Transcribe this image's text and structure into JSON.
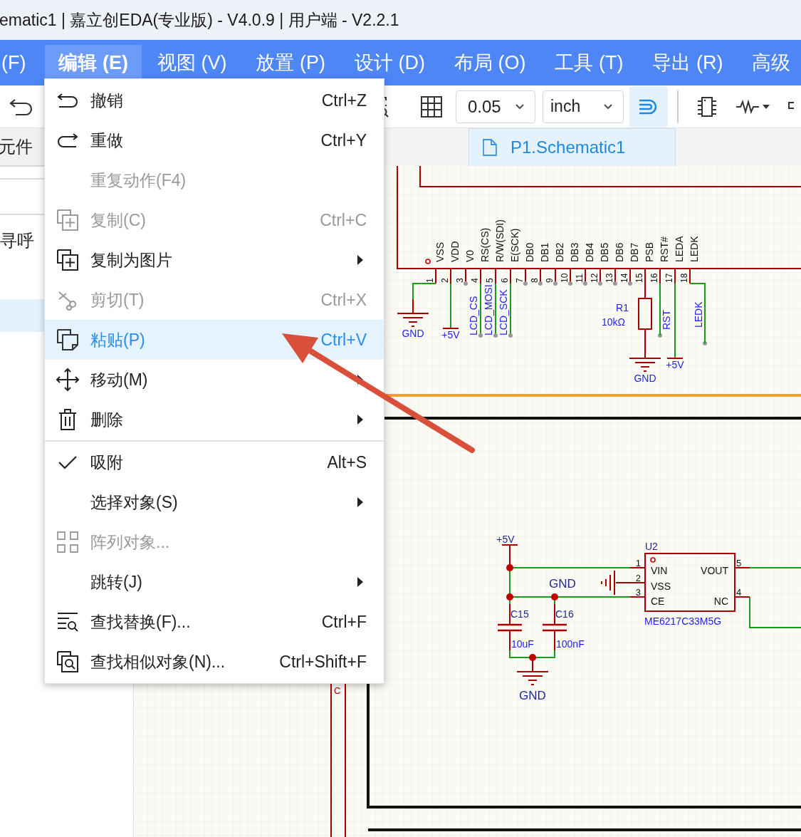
{
  "window": {
    "title": "ematic1 | 嘉立创EDA(专业版) - V4.0.9 | 用户端 - V2.2.1"
  },
  "menubar": [
    {
      "label": "(F)",
      "selected": false
    },
    {
      "label": "编辑 (E)",
      "selected": true
    },
    {
      "label": "视图 (V)",
      "selected": false
    },
    {
      "label": "放置 (P)",
      "selected": false
    },
    {
      "label": "设计 (D)",
      "selected": false
    },
    {
      "label": "布局 (O)",
      "selected": false
    },
    {
      "label": "工具 (T)",
      "selected": false
    },
    {
      "label": "导出 (R)",
      "selected": false
    },
    {
      "label": "高级",
      "selected": false
    }
  ],
  "toolbar": {
    "grid_size": "0.05",
    "unit": "inch",
    "snap_on": true
  },
  "left_panel": {
    "header": "元件",
    "item": "寻呼"
  },
  "tabs": [
    {
      "label": "P1.Schematic1",
      "selected": true
    }
  ],
  "edit_menu": [
    {
      "kind": "item",
      "label": "撤销",
      "shortcut": "Ctrl+Z",
      "disabled": false,
      "selected": false,
      "checked": false,
      "submenu": false
    },
    {
      "kind": "item",
      "label": "重做",
      "shortcut": "Ctrl+Y",
      "disabled": false,
      "selected": false,
      "checked": false,
      "submenu": false
    },
    {
      "kind": "item",
      "label": "重复动作(F4)",
      "disabled": true,
      "selected": false,
      "checked": false,
      "submenu": false
    },
    {
      "kind": "item",
      "label": "复制(C)",
      "shortcut": "Ctrl+C",
      "disabled": true,
      "selected": false,
      "checked": false,
      "submenu": false
    },
    {
      "kind": "item",
      "label": "复制为图片",
      "disabled": false,
      "selected": false,
      "checked": false,
      "submenu": true
    },
    {
      "kind": "item",
      "label": "剪切(T)",
      "shortcut": "Ctrl+X",
      "disabled": true,
      "selected": false,
      "checked": false,
      "submenu": false
    },
    {
      "kind": "item",
      "label": "粘贴(P)",
      "shortcut": "Ctrl+V",
      "disabled": false,
      "selected": true,
      "checked": false,
      "submenu": false
    },
    {
      "kind": "item",
      "label": "移动(M)",
      "disabled": false,
      "selected": false,
      "checked": false,
      "submenu": true
    },
    {
      "kind": "item",
      "label": "删除",
      "disabled": false,
      "selected": false,
      "checked": false,
      "submenu": true
    },
    {
      "kind": "separator"
    },
    {
      "kind": "item",
      "label": "吸附",
      "shortcut": "Alt+S",
      "disabled": false,
      "selected": false,
      "checked": true,
      "submenu": false
    },
    {
      "kind": "item",
      "label": "选择对象(S)",
      "disabled": false,
      "selected": false,
      "checked": false,
      "submenu": true
    },
    {
      "kind": "item",
      "label": "阵列对象...",
      "disabled": true,
      "selected": false,
      "checked": false,
      "submenu": false
    },
    {
      "kind": "item",
      "label": "跳转(J)",
      "disabled": false,
      "selected": false,
      "checked": false,
      "submenu": true
    },
    {
      "kind": "item",
      "label": "查找替换(F)...",
      "shortcut": "Ctrl+F",
      "disabled": false,
      "selected": false,
      "checked": false,
      "submenu": false
    },
    {
      "kind": "item",
      "label": "查找相似对象(N)...",
      "shortcut": "Ctrl+Shift+F",
      "disabled": false,
      "selected": false,
      "checked": false,
      "submenu": false
    }
  ],
  "schematic": {
    "lcd_pins": [
      {
        "number": "1",
        "name": "VSS"
      },
      {
        "number": "2",
        "name": "VDD"
      },
      {
        "number": "3",
        "name": "V0"
      },
      {
        "number": "4",
        "name": "RS(CS)"
      },
      {
        "number": "5",
        "name": "R/W(SDI)"
      },
      {
        "number": "6",
        "name": "E(SCK)"
      },
      {
        "number": "7",
        "name": "DB0"
      },
      {
        "number": "8",
        "name": "DB1"
      },
      {
        "number": "9",
        "name": "DB2"
      },
      {
        "number": "10",
        "name": "DB3"
      },
      {
        "number": "11",
        "name": "DB4"
      },
      {
        "number": "12",
        "name": "DB5"
      },
      {
        "number": "13",
        "name": "DB6"
      },
      {
        "number": "14",
        "name": "DB7"
      },
      {
        "number": "15",
        "name": "PSB"
      },
      {
        "number": "16",
        "name": "RST#"
      },
      {
        "number": "17",
        "name": "LEDA"
      },
      {
        "number": "18",
        "name": "LEDK"
      }
    ],
    "lcd_labels": [
      "GND",
      "+5V",
      "LCD_CS",
      "LCD_MOSI",
      "LCD_SCK",
      "R1",
      "10kΩ",
      "GND",
      "RST",
      "+5V",
      "LEDK"
    ],
    "regulator": {
      "ref": "U2",
      "part": "ME6217C33M5G",
      "pins": [
        {
          "number": "1",
          "name": "VIN"
        },
        {
          "number": "2",
          "name": "VSS"
        },
        {
          "number": "3",
          "name": "CE"
        },
        {
          "number": "5",
          "name": "VOUT"
        },
        {
          "number": "4",
          "name": "NC"
        }
      ]
    },
    "regulator_labels": [
      "+5V",
      "GND",
      "C15",
      "C16",
      "10uF",
      "100nF",
      "GND"
    ],
    "fragment_label": "C"
  }
}
